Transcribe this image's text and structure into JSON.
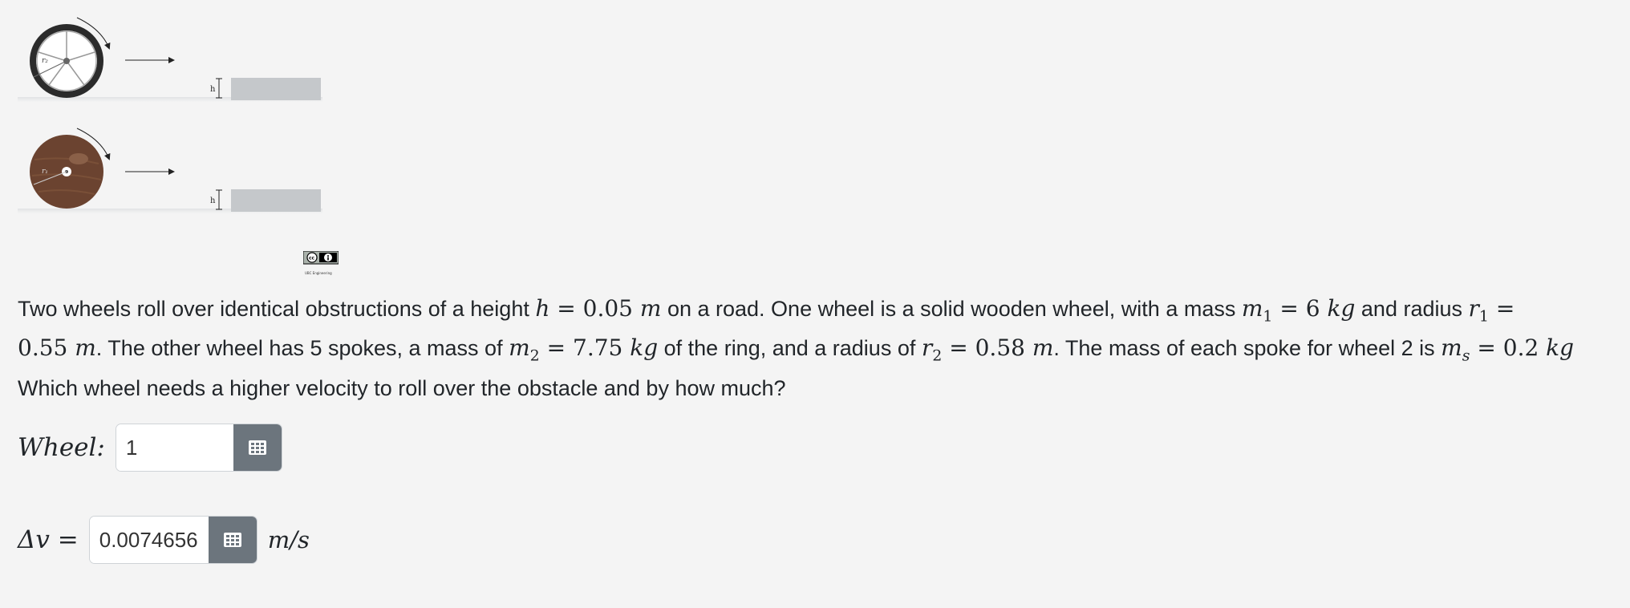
{
  "figure": {
    "wheel1_label": "r₂",
    "wheel2_label": "r₁",
    "height_label": "h",
    "license_text": "UBC Engineering"
  },
  "problem": {
    "p1": "Two wheels roll over identical obstructions of a height ",
    "m1": "h",
    "m2": " = ",
    "m3": "0.05",
    "m4": " m",
    "p2": " on a road. One wheel is a solid wooden wheel, with a mass ",
    "m5": "m",
    "m6": "1",
    "m7": " = ",
    "m8": "6",
    "m9": " kg",
    "p3": " and radius ",
    "m10": "r",
    "m11": "1",
    "m12": " =",
    "m13": "0.55",
    "m14": " m",
    "p4": ". The other wheel has 5 spokes, a mass of ",
    "m15": "m",
    "m16": "2",
    "m17": " = ",
    "m18": "7.75",
    "m19": " kg",
    "p5": " of the ring, and a radius of ",
    "m20": "r",
    "m21": "2",
    "m22": " = ",
    "m23": "0.58",
    "m24": " m",
    "p6": ". The mass of each spoke for wheel 2 is ",
    "m25": "m",
    "m26": "s",
    "m27": " = ",
    "m28": "0.2",
    "m29": " kg",
    "p7": "Which wheel needs a higher velocity to roll over the obstacle and by how much?"
  },
  "wheel_answer": {
    "label": "Wheel:",
    "value": "1"
  },
  "dv_answer": {
    "label": "Δv =",
    "value": "0.0074656",
    "unit": "m/s"
  },
  "colors": {
    "button": "#6c757d",
    "wood": "#6b4330",
    "tire": "#2b2b2b",
    "obstacle": "#c5c8cb"
  }
}
